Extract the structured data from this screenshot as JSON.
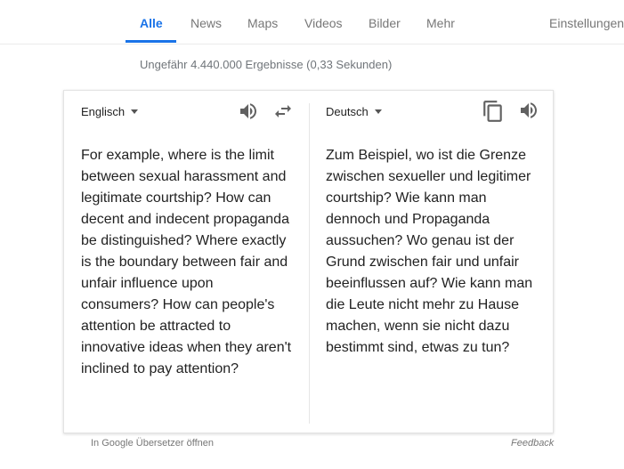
{
  "nav": {
    "tabs": [
      {
        "label": "Alle",
        "active": true
      },
      {
        "label": "News",
        "active": false
      },
      {
        "label": "Maps",
        "active": false
      },
      {
        "label": "Videos",
        "active": false
      },
      {
        "label": "Bilder",
        "active": false
      },
      {
        "label": "Mehr",
        "active": false
      }
    ],
    "settings_label": "Einstellungen",
    "accent_color": "#1a73e8"
  },
  "results_stats": "Ungefähr 4.440.000 Ergebnisse (0,33 Sekunden)",
  "translator": {
    "source_language": "Englisch",
    "target_language": "Deutsch",
    "source_text": "For example, where is the limit between sexual harassment and legitimate courtship? How can decent and indecent propaganda be distinguished? Where exactly is the boundary between fair and unfair influence upon consumers? How can people's attention be attracted to innovative ideas when they aren't inclined to pay attention?",
    "target_text": "Zum Beispiel, wo ist die Grenze zwischen sexueller und legitimer courtship? Wie kann man dennoch und Propaganda aussuchen? Wo genau ist der Grund zwischen fair und unfair beeinflussen auf? Wie kann man die Leute nicht mehr zu Hause machen, wenn sie nicht dazu bestimmt sind, etwas zu tun?",
    "icons": {
      "source_listen": "speaker-icon",
      "swap": "swap-arrows-icon",
      "copy": "copy-icon",
      "target_listen": "speaker-icon"
    }
  },
  "footer": {
    "open_translate": "In Google Übersetzer öffnen",
    "feedback": "Feedback"
  }
}
